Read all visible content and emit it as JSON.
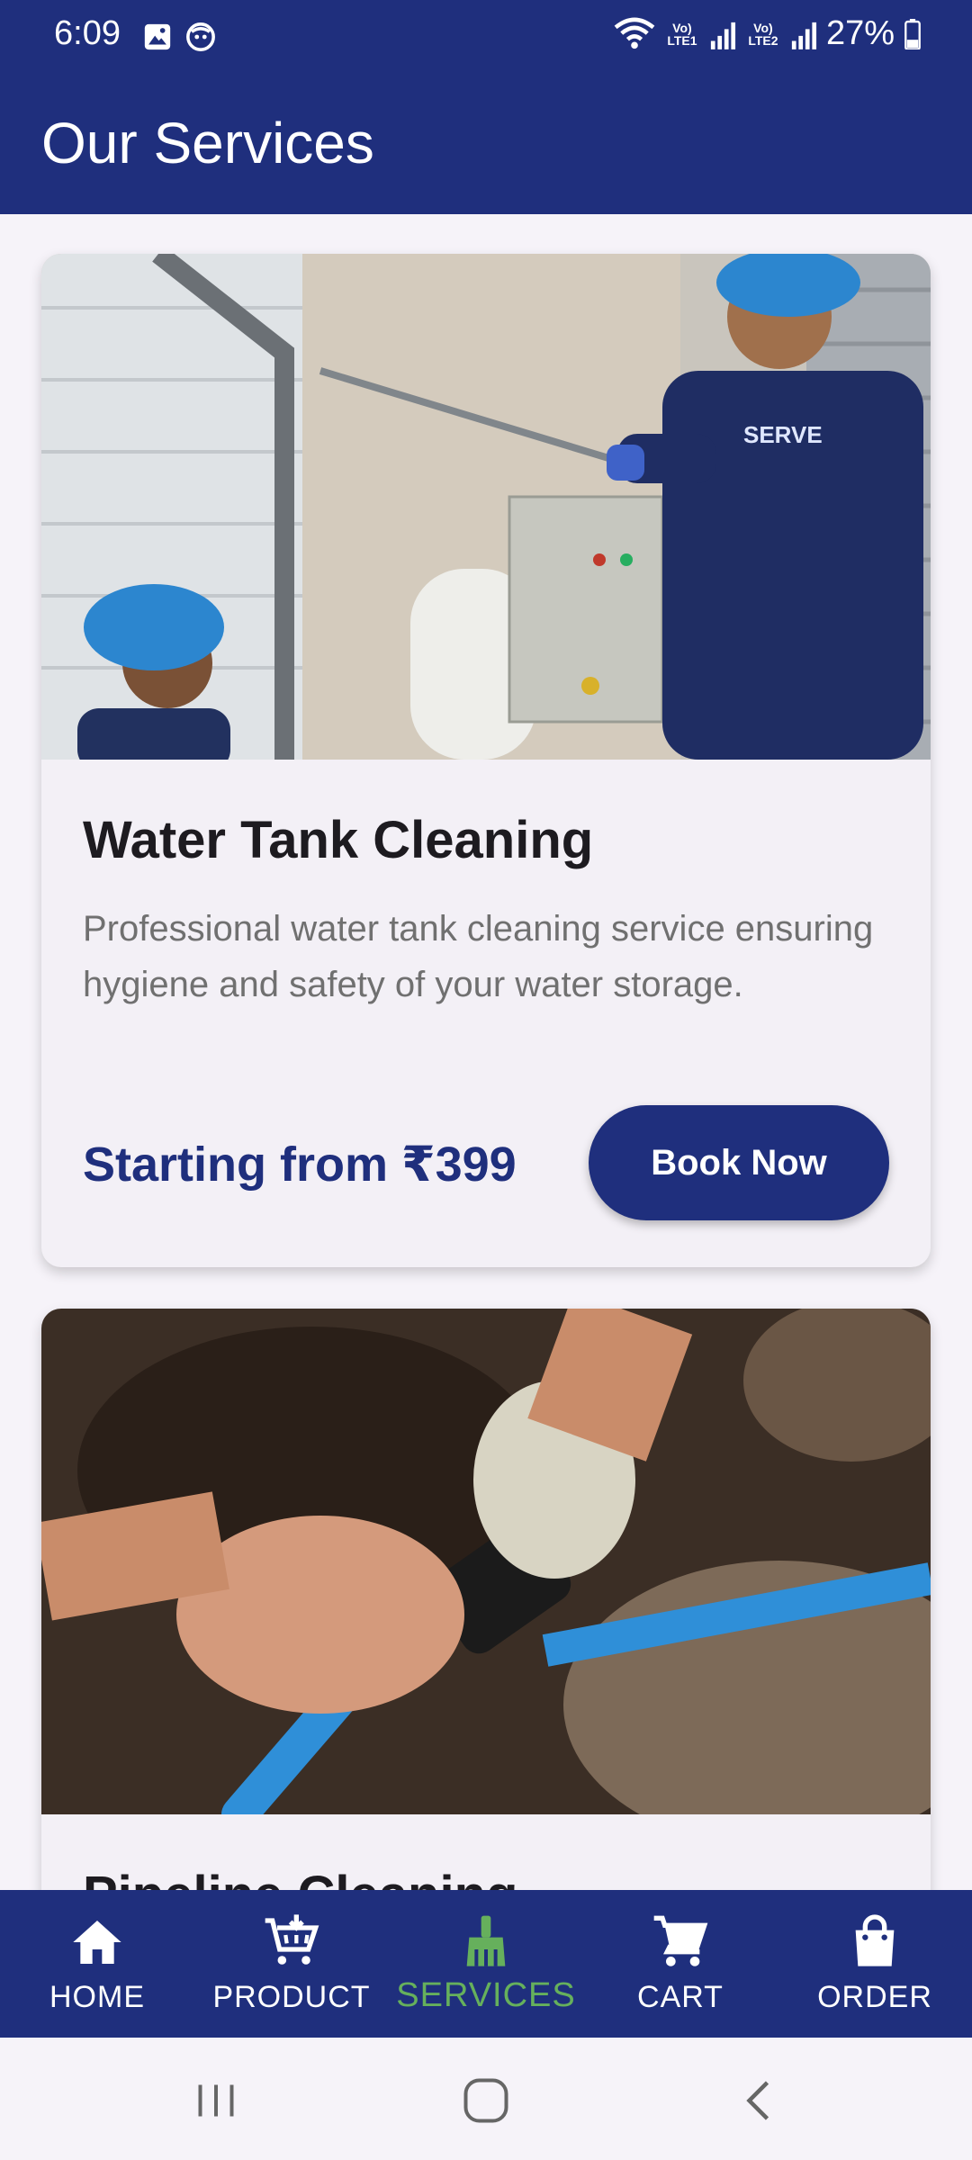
{
  "status_bar": {
    "time": "6:09",
    "sim1": "Vo) LTE1",
    "sim2": "Vo) LTE2",
    "battery": "27%",
    "left_icons": [
      "gallery-icon",
      "face-icon"
    ],
    "right_icons": [
      "wifi-icon",
      "signal-icon",
      "signal-icon",
      "battery-icon"
    ]
  },
  "app_bar": {
    "title": "Our Services"
  },
  "services": [
    {
      "title": "Water Tank Cleaning",
      "description": "Professional water tank cleaning service ensuring hygiene and safety of your water storage.",
      "price": "Starting from ₹399",
      "button": "Book Now",
      "image": "water-tank-technicians-photo",
      "uniform_logo_text": "SERVE"
    },
    {
      "title": "Pipeline Cleaning",
      "image": "pipeline-hands-photo"
    }
  ],
  "bottom_nav": {
    "items": [
      {
        "label": "HOME",
        "icon": "home-icon",
        "active": false
      },
      {
        "label": "PRODUCT",
        "icon": "cart-plus-icon",
        "active": false
      },
      {
        "label": "SERVICES",
        "icon": "broom-icon",
        "active": true
      },
      {
        "label": "CART",
        "icon": "shopping-cart-icon",
        "active": false
      },
      {
        "label": "ORDER",
        "icon": "shopping-bag-icon",
        "active": false
      }
    ],
    "active_color": "#66b05c"
  },
  "system_nav": {
    "buttons": [
      "recents-icon",
      "home-circle-icon",
      "back-icon"
    ]
  },
  "colors": {
    "primary": "#1f2f7d",
    "background": "#f6f3f9",
    "card": "#f3f0f6",
    "accent": "#66b05c"
  }
}
